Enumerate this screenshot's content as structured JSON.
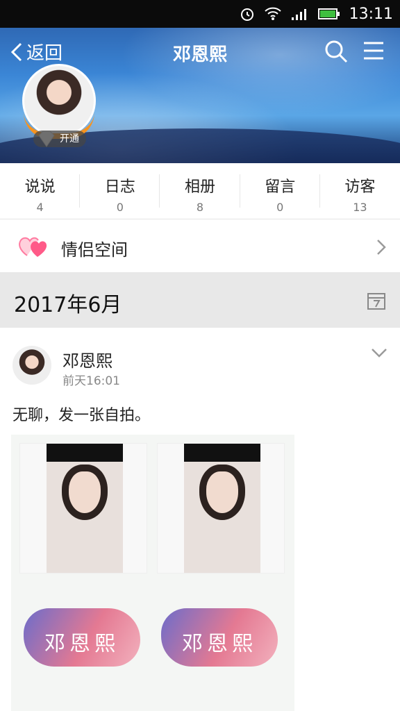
{
  "status": {
    "time": "13:11"
  },
  "header": {
    "back_label": "返回",
    "title": "邓恩熙"
  },
  "profile": {
    "vip_label": "开通"
  },
  "stats": [
    {
      "label": "说说",
      "count": "4"
    },
    {
      "label": "日志",
      "count": "0"
    },
    {
      "label": "相册",
      "count": "8"
    },
    {
      "label": "留言",
      "count": "0"
    },
    {
      "label": "访客",
      "count": "13"
    }
  ],
  "couple": {
    "label": "情侣空间"
  },
  "timeline": {
    "month": "2017年6月"
  },
  "post": {
    "author": "邓恩熙",
    "time": "前天16:01",
    "text": "无聊，发一张自拍。",
    "image_caption": "邓恩熙"
  },
  "colors": {
    "accent_orange": "#f7931e",
    "heart_pink": "#ff5a88"
  }
}
